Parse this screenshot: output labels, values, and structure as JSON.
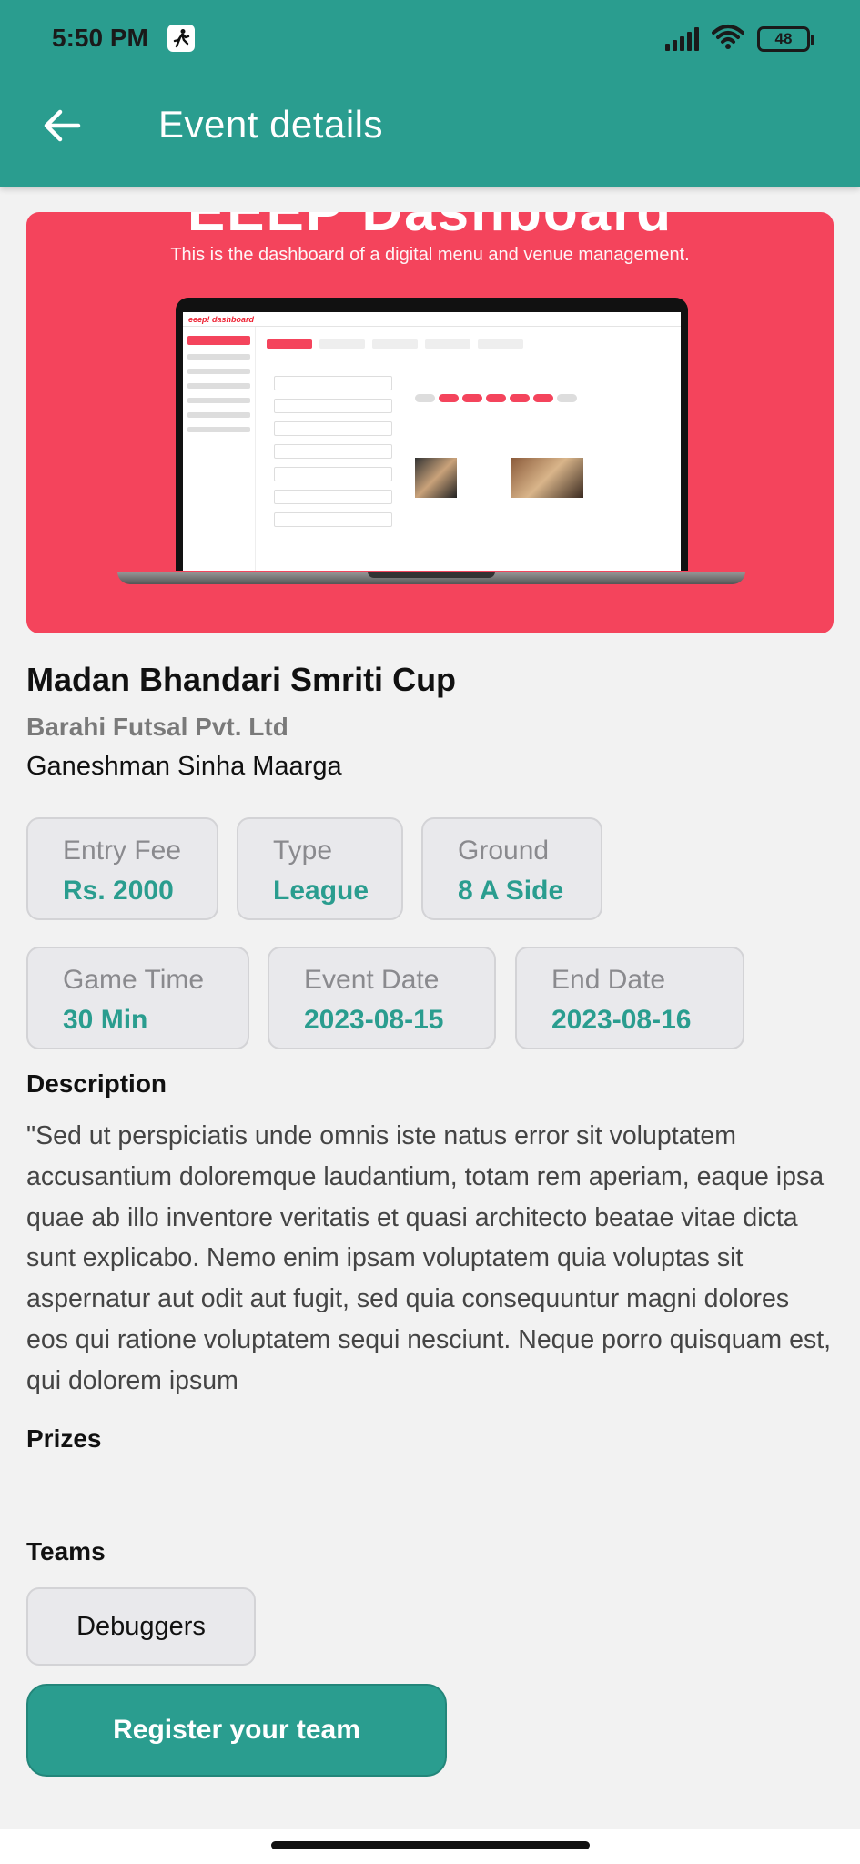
{
  "status_bar": {
    "time": "5:50 PM",
    "notif_icon": "running-figure-icon",
    "battery": "48"
  },
  "header": {
    "back_icon": "arrow-left-icon",
    "title": "Event details"
  },
  "banner": {
    "title": "EEEP Dashboard",
    "subtitle": "This is the dashboard of a digital menu  and venue management.",
    "screen_brand": "eeep! dashboard"
  },
  "event": {
    "name": "Madan Bhandari Smriti Cup",
    "organizer": "Barahi Futsal Pvt. Ltd",
    "location": "Ganeshman Sinha Maarga"
  },
  "info": [
    {
      "label": "Entry Fee",
      "value": "Rs. 2000"
    },
    {
      "label": "Type",
      "value": "League"
    },
    {
      "label": "Ground",
      "value": "8 A Side"
    },
    {
      "label": "Game Time",
      "value": "30 Min"
    },
    {
      "label": "Event Date",
      "value": "2023-08-15"
    },
    {
      "label": "End Date",
      "value": "2023-08-16"
    }
  ],
  "description": {
    "heading": "Description",
    "text": "\"Sed ut perspiciatis unde omnis iste natus error sit voluptatem accusantium doloremque laudantium, totam rem aperiam, eaque ipsa quae ab illo inventore veritatis et quasi architecto beatae vitae dicta sunt explicabo. Nemo enim ipsam voluptatem quia voluptas sit aspernatur aut odit aut fugit, sed quia consequuntur magni dolores eos qui ratione voluptatem sequi nesciunt. Neque porro quisquam est, qui dolorem ipsum"
  },
  "prizes": {
    "heading": "Prizes"
  },
  "teams": {
    "heading": "Teams",
    "items": [
      "Debuggers"
    ]
  },
  "register_button": "Register your team",
  "colors": {
    "primary": "#2a9d8f",
    "banner": "#f4445c",
    "background": "#f2f2f2"
  }
}
